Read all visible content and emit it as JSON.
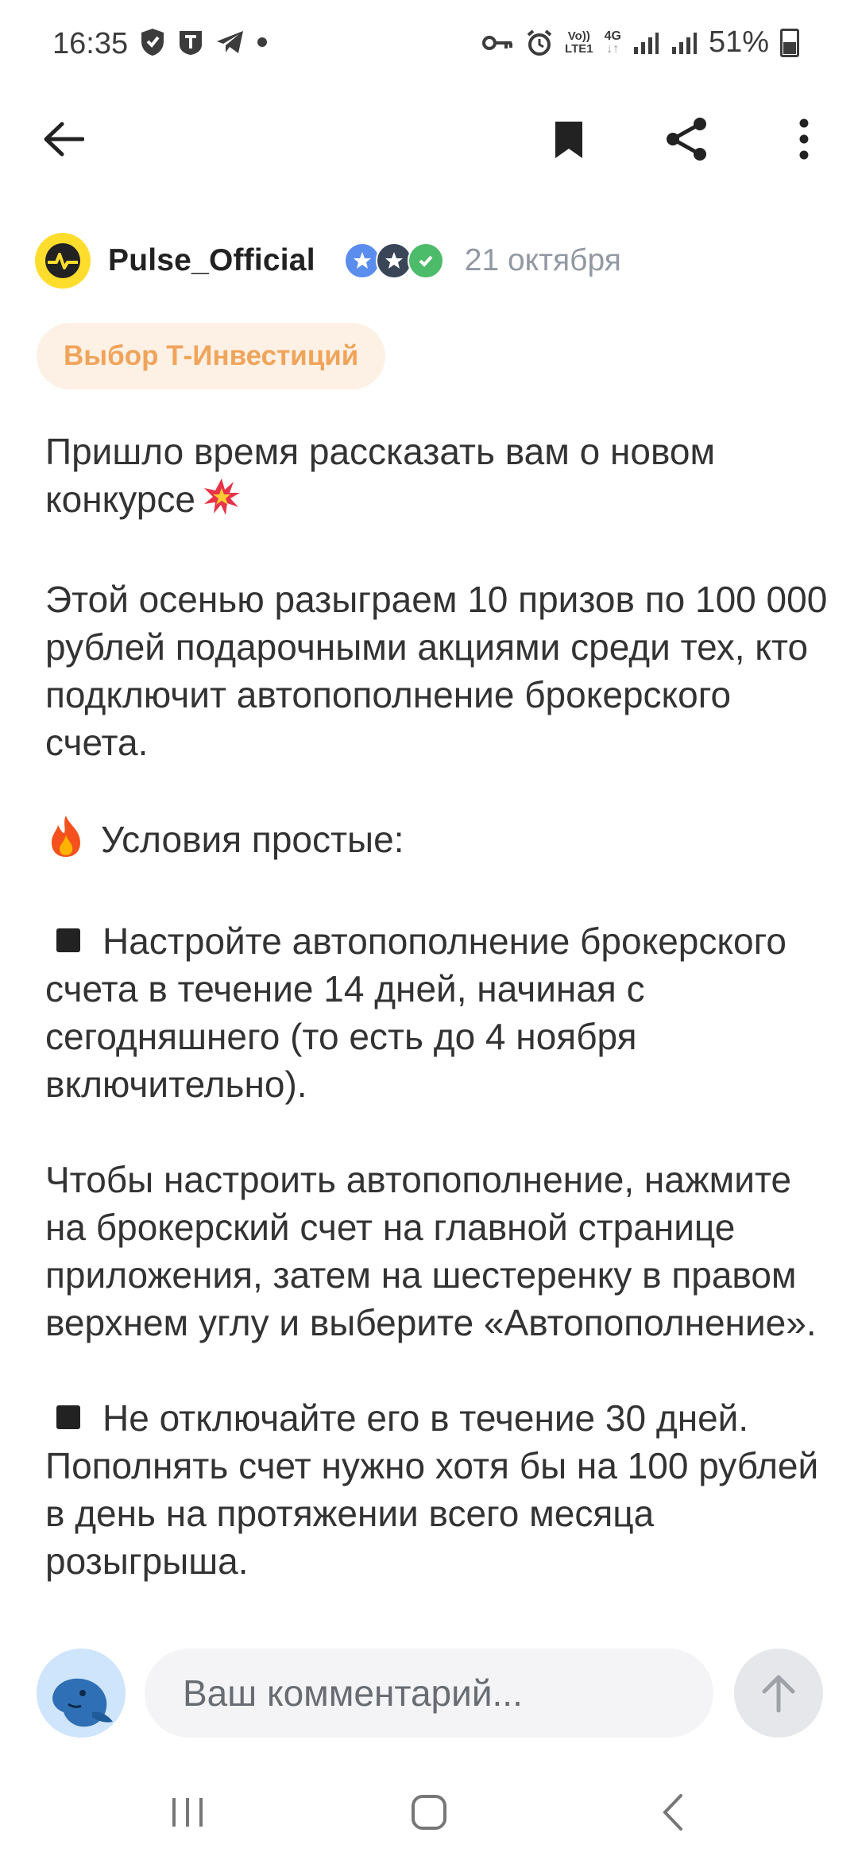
{
  "status_bar": {
    "time": "16:35",
    "battery": "51%",
    "network_labels": [
      "Vo))",
      "LTE1",
      "4G"
    ],
    "icons": [
      "shield-icon",
      "t-app-icon",
      "telegram-icon",
      "dot-icon",
      "key-icon",
      "alarm-icon",
      "volte-icon",
      "signal-icon",
      "battery-icon"
    ]
  },
  "app_bar": {
    "icons": [
      "back-arrow-icon",
      "bookmark-icon",
      "share-icon",
      "more-vert-icon"
    ]
  },
  "post": {
    "author": "Pulse_Official",
    "date": "21 октября",
    "tag": "Выбор Т-Инвестиций",
    "paragraphs": [
      "Пришло время рассказать вам о новом конкурсе",
      "Этой осенью разыграем 10 призов по 100 000 рублей подарочными акциями среди тех, кто подключит автопополнение брокерского счета.",
      "Условия простые:",
      "Настройте автопополнение брокерского счета в течение 14 дней, начиная с сегодняшнего (то есть до 4 ноября включительно).",
      "Чтобы настроить автопополнение, нажмите на брокерский счет на главной странице приложения, затем на шестеренку в правом верхнем углу и выберите «Автопополнение».",
      "Не отключайте его в течение 30 дней. Пополнять счет нужно хотя бы на 100 рублей в день на протяжении всего месяца розыгрыша."
    ]
  },
  "comment": {
    "placeholder": "Ваш комментарий..."
  },
  "colors": {
    "accent_yellow": "#ffdd2d",
    "tag_bg": "#fdf1e6",
    "tag_text": "#f0a45a",
    "date_gray": "#9299a2",
    "badge_blue": "#5b8def",
    "badge_dark": "#3a4658",
    "badge_green": "#4cbb6a"
  }
}
